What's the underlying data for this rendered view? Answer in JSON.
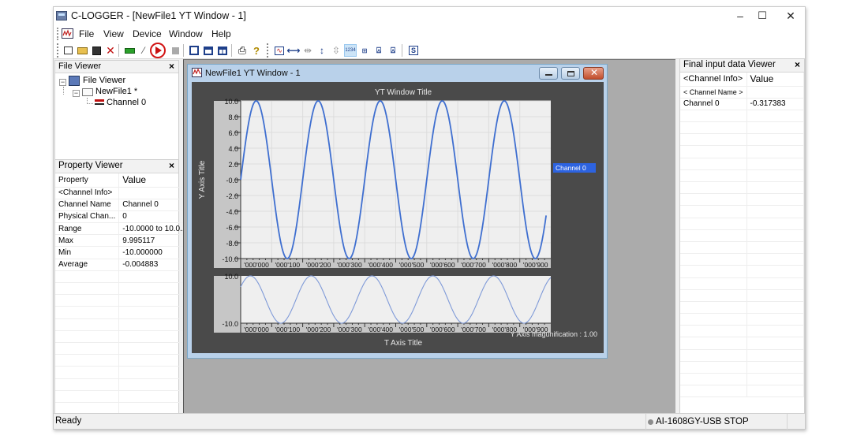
{
  "window": {
    "title": "C-LOGGER - [NewFile1 YT Window - 1]",
    "controls": {
      "minimize": "–",
      "maximize": "☐",
      "close": "✕"
    }
  },
  "menu": {
    "items": [
      "File",
      "View",
      "Device",
      "Window",
      "Help"
    ]
  },
  "toolbar": {
    "buttons": [
      {
        "name": "new-file",
        "glyph": "☐"
      },
      {
        "name": "open-file",
        "glyph": "📂"
      },
      {
        "name": "save-file",
        "glyph": "💾"
      },
      {
        "name": "delete",
        "glyph": "✕"
      },
      {
        "name": "device",
        "glyph": "▬"
      },
      {
        "name": "wizard",
        "glyph": "⚡"
      },
      {
        "name": "start",
        "glyph": "▶"
      },
      {
        "name": "stop",
        "glyph": "■"
      },
      {
        "name": "cascade",
        "glyph": "❐"
      },
      {
        "name": "tile-horizontal",
        "glyph": "⊟"
      },
      {
        "name": "tile-vertical",
        "glyph": "◫"
      },
      {
        "name": "print",
        "glyph": "⎙"
      },
      {
        "name": "help",
        "glyph": "?"
      },
      {
        "name": "yt-window",
        "glyph": "∿"
      },
      {
        "name": "fit-horizontal",
        "glyph": "↔"
      },
      {
        "name": "zoom-horizontal",
        "glyph": "⇹"
      },
      {
        "name": "fit-vertical",
        "glyph": "↕"
      },
      {
        "name": "zoom-vertical",
        "glyph": "⇳"
      },
      {
        "name": "digital-display",
        "glyph": "1234"
      },
      {
        "name": "scale",
        "glyph": "⊞"
      },
      {
        "name": "cursor-a",
        "glyph": "A"
      },
      {
        "name": "cursor-b",
        "glyph": "B"
      },
      {
        "name": "statistics",
        "glyph": "S"
      }
    ]
  },
  "file_viewer": {
    "title": "File Viewer",
    "close": "×",
    "tree": {
      "root": "File Viewer",
      "file": "NewFile1 *",
      "channel": "Channel 0"
    }
  },
  "property_viewer": {
    "title": "Property Viewer",
    "close": "×",
    "headers": [
      "Property",
      "Value"
    ],
    "rows": [
      [
        "<Channel Info>",
        ""
      ],
      [
        "Channel Name",
        "Channel 0"
      ],
      [
        "Physical Chan...",
        "0"
      ],
      [
        "Range",
        "-10.0000 to 10.0..."
      ],
      [
        "Max",
        "9.995117"
      ],
      [
        "Min",
        "-10.000000"
      ],
      [
        "Average",
        "-0.004883"
      ]
    ]
  },
  "final_viewer": {
    "title": "Final input data Viewer",
    "close": "×",
    "headers": [
      "<Channel Info>",
      "Value"
    ],
    "subheader": "< Channel Name >",
    "rows": [
      [
        "Channel 0",
        "-0.317383"
      ]
    ]
  },
  "yt_window": {
    "title": "NewFile1 YT Window - 1",
    "magnification": "Y Axis magunification : 1.00"
  },
  "colors": {
    "trace": "#3f6fd0",
    "trace_light": "#7f9ad8",
    "legend_bg": "#2d63e0",
    "play_ring": "#d21414"
  },
  "chart_data": {
    "type": "line",
    "title": "YT Window Title",
    "xlabel": "T Axis Title",
    "ylabel": "Y Axis Title",
    "ylim": [
      -10,
      10
    ],
    "xlim": [
      0,
      1000
    ],
    "yticks": [
      "10.0",
      "8.0",
      "6.0",
      "4.0",
      "2.0",
      "-0.0",
      "-2.0",
      "-4.0",
      "-6.0",
      "-8.0",
      "-10.0"
    ],
    "xticks": [
      "'000'000",
      "'000'100",
      "'000'200",
      "'000'300",
      "'000'400",
      "'000'500",
      "'000'600",
      "'000'700",
      "'000'800",
      "'000'900"
    ],
    "overview_yticks": [
      "10.0",
      "-10.0"
    ],
    "grid": true,
    "legend": {
      "entries": [
        "Channel 0"
      ],
      "placement": "right"
    },
    "series": [
      {
        "name": "Channel 0",
        "waveform": "sine",
        "amplitude": 10,
        "offset": 0,
        "period": 200,
        "start_phase_deg": 0,
        "x": [
          0,
          50,
          100,
          150,
          200,
          250,
          300,
          350,
          400,
          450,
          500,
          550,
          600,
          650,
          700,
          750,
          800,
          850,
          900,
          950,
          1000
        ],
        "values": [
          0,
          10,
          0,
          -10,
          0,
          10,
          0,
          -10,
          0,
          10,
          0,
          -10,
          0,
          10,
          0,
          -10,
          0,
          10,
          0,
          -10,
          0
        ]
      }
    ]
  },
  "status": {
    "left": "Ready",
    "device": "AI-1608GY-USB STOP"
  }
}
